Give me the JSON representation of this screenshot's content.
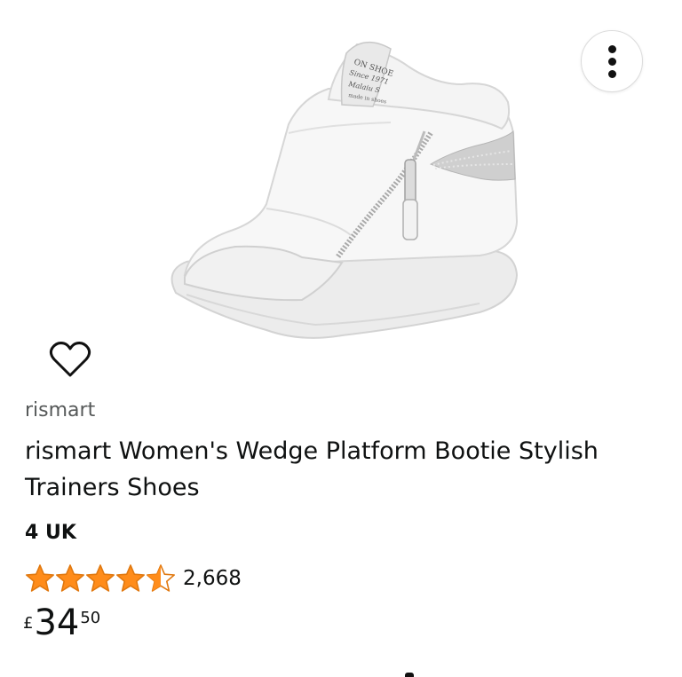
{
  "product": {
    "image_print": [
      "ON SHOE",
      "Since 1971",
      "Malaiu S",
      "made in shoes"
    ],
    "brand": "rismart",
    "title": "rismart Women's Wedge Platform Bootie Stylish Trainers Shoes",
    "size": "4 UK",
    "rating": {
      "value": 4.5,
      "max": 5,
      "count": "2,668"
    },
    "price": {
      "symbol": "£",
      "whole": "34",
      "fraction": "50"
    }
  },
  "icons": {
    "more": "more-vertical-icon",
    "wishlist": "heart-outline-icon",
    "star": "star-icon"
  },
  "colors": {
    "star_fill": "#ff8c1a",
    "star_outline": "#e0780f",
    "brand_text": "#565959",
    "text": "#0f1111"
  }
}
